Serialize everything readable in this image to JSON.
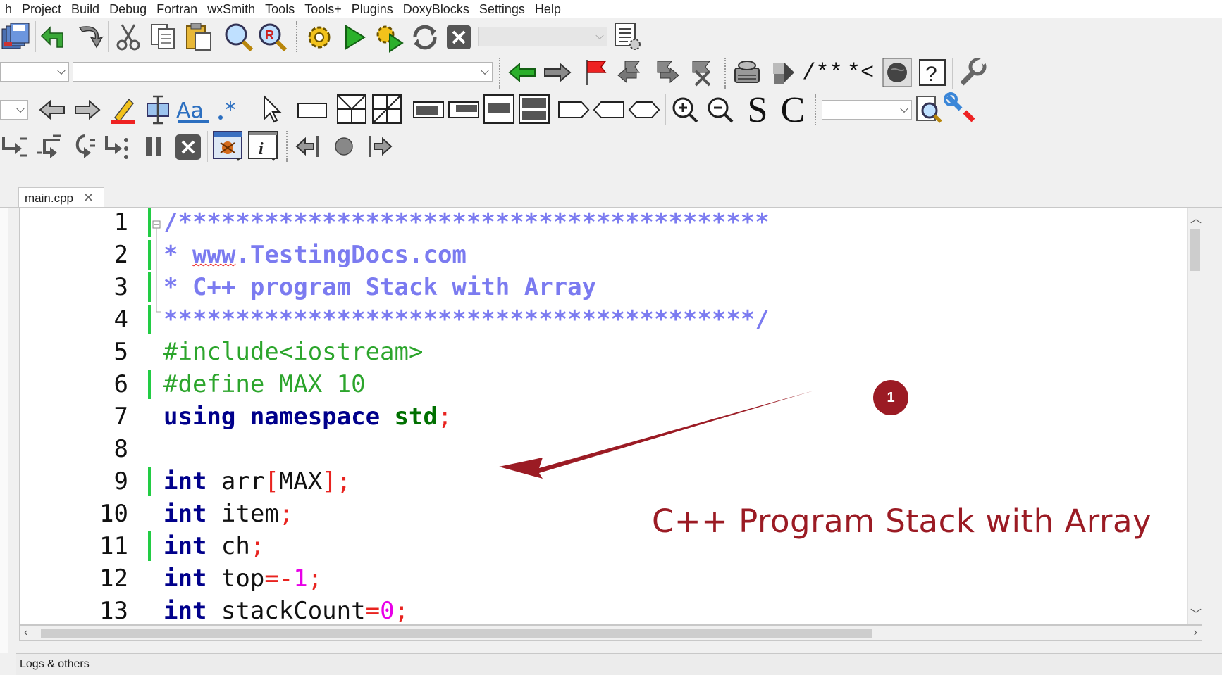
{
  "menu": [
    "h",
    "Project",
    "Build",
    "Debug",
    "Fortran",
    "wxSmith",
    "Tools",
    "Tools+",
    "Plugins",
    "DoxyBlocks",
    "Settings",
    "Help"
  ],
  "toolbar_text": {
    "doxy_comment": "/**",
    "doxy_inline": "*<",
    "search_s": "S",
    "search_c": "C"
  },
  "tab": {
    "label": "main.cpp",
    "close": "✕"
  },
  "code": {
    "line_numbers": [
      "1",
      "2",
      "3",
      "4",
      "5",
      "6",
      "7",
      "8",
      "9",
      "10",
      "11",
      "12",
      "13"
    ],
    "lines": [
      [
        {
          "t": "/*****************************************",
          "c": "c-com"
        }
      ],
      [
        {
          "t": "* ",
          "c": "c-com"
        },
        {
          "t": "www",
          "c": "c-com ul-red"
        },
        {
          "t": ".TestingDocs.com",
          "c": "c-com"
        }
      ],
      [
        {
          "t": "* C++ program Stack with Array",
          "c": "c-com"
        }
      ],
      [
        {
          "t": "*****************************************/",
          "c": "c-com"
        }
      ],
      [
        {
          "t": "#include<iostream>",
          "c": "c-pre"
        }
      ],
      [
        {
          "t": "#define MAX 10",
          "c": "c-pre"
        }
      ],
      [
        {
          "t": "using namespace ",
          "c": "c-kw"
        },
        {
          "t": "std",
          "c": "c-std"
        },
        {
          "t": ";",
          "c": "c-op"
        }
      ],
      [],
      [
        {
          "t": "int ",
          "c": "c-kw"
        },
        {
          "t": "arr",
          "c": "c-txt"
        },
        {
          "t": "[",
          "c": "c-op"
        },
        {
          "t": "MAX",
          "c": "c-txt"
        },
        {
          "t": "];",
          "c": "c-op"
        }
      ],
      [
        {
          "t": "int ",
          "c": "c-kw"
        },
        {
          "t": "item",
          "c": "c-txt"
        },
        {
          "t": ";",
          "c": "c-op"
        }
      ],
      [
        {
          "t": "int ",
          "c": "c-kw"
        },
        {
          "t": "ch",
          "c": "c-txt"
        },
        {
          "t": ";",
          "c": "c-op"
        }
      ],
      [
        {
          "t": "int ",
          "c": "c-kw"
        },
        {
          "t": "top",
          "c": "c-txt"
        },
        {
          "t": "=-",
          "c": "c-op"
        },
        {
          "t": "1",
          "c": "c-num"
        },
        {
          "t": ";",
          "c": "c-op"
        }
      ],
      [
        {
          "t": "int ",
          "c": "c-kw"
        },
        {
          "t": "stackCount",
          "c": "c-txt"
        },
        {
          "t": "=",
          "c": "c-op"
        },
        {
          "t": "0",
          "c": "c-num"
        },
        {
          "t": ";",
          "c": "c-op"
        }
      ]
    ],
    "changed_lines": [
      1,
      2,
      3,
      4,
      6,
      9,
      11
    ]
  },
  "annotation": {
    "badge": "1",
    "text": "C++ Program Stack with Array",
    "color": "#9b1b24"
  },
  "bottom_panel": {
    "label": "Logs & others"
  },
  "colors": {
    "comment": "#7b7bf0",
    "preprocessor": "#2ca52c",
    "keyword": "#00008b",
    "operator": "#e8231f",
    "number": "#e800e8",
    "change_bar": "#22cc44"
  }
}
